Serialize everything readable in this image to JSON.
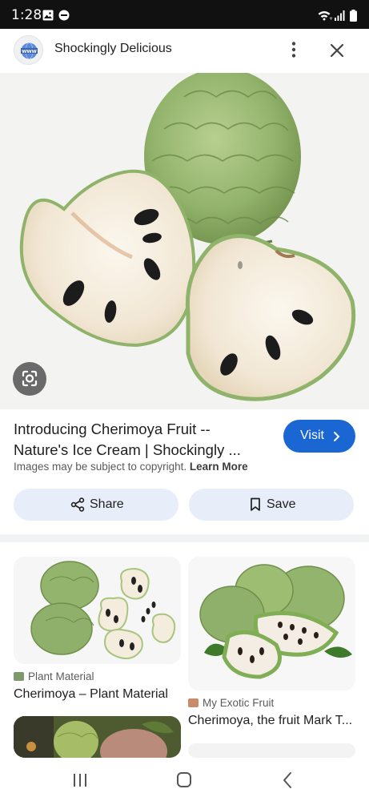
{
  "status_bar": {
    "time": "1:28",
    "icons": [
      "image-icon",
      "do-not-disturb-icon",
      "wifi-icon",
      "signal-icon",
      "battery-icon"
    ]
  },
  "header": {
    "site_name": "Shockingly Delicious",
    "favicon": "www-globe-icon",
    "more_icon": "more-vert-icon",
    "close_icon": "close-icon"
  },
  "hero": {
    "subject": "cherimoya-photo",
    "lens_icon": "google-lens-icon"
  },
  "result": {
    "title_line1": "Introducing Cherimoya Fruit --",
    "title_line2": "Nature's Ice Cream | Shockingly ...",
    "visit_label": "Visit",
    "copyright_text": "Images may be subject to copyright.",
    "learn_more": "Learn More"
  },
  "actions": {
    "share_label": "Share",
    "save_label": "Save"
  },
  "related": [
    {
      "source": "Plant Material",
      "title": "Cherimoya – Plant Material"
    },
    {
      "source": "My Exotic Fruit",
      "title": "Cherimoya, the fruit Mark T..."
    }
  ],
  "navbar": {
    "icons": [
      "recent-apps-icon",
      "home-icon",
      "back-icon"
    ]
  },
  "colors": {
    "accent": "#1a66d2",
    "pill_bg": "#e7eef9",
    "fruit_skin": "#8fb36a",
    "fruit_flesh": "#f6efe2"
  }
}
